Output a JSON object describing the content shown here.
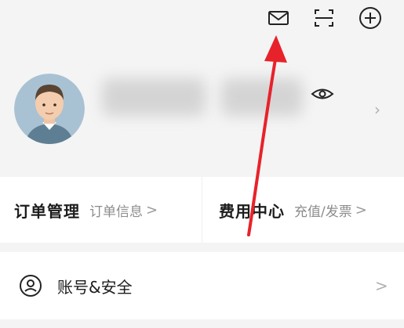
{
  "header": {
    "icons": [
      "mail-icon",
      "scan-icon",
      "add-icon"
    ]
  },
  "profile": {
    "visibility_icon": "eye-icon"
  },
  "cards": {
    "orders": {
      "title": "订单管理",
      "subtitle": "订单信息",
      "chevron": ">"
    },
    "billing": {
      "title": "费用中心",
      "subtitle": "充值/发票",
      "chevron": ">"
    }
  },
  "menu": {
    "account_security": {
      "label": "账号&安全",
      "icon": "user-circle-icon",
      "chevron": ">"
    }
  },
  "colors": {
    "annotation_arrow": "#e8222a",
    "background": "#f4f4f4"
  }
}
